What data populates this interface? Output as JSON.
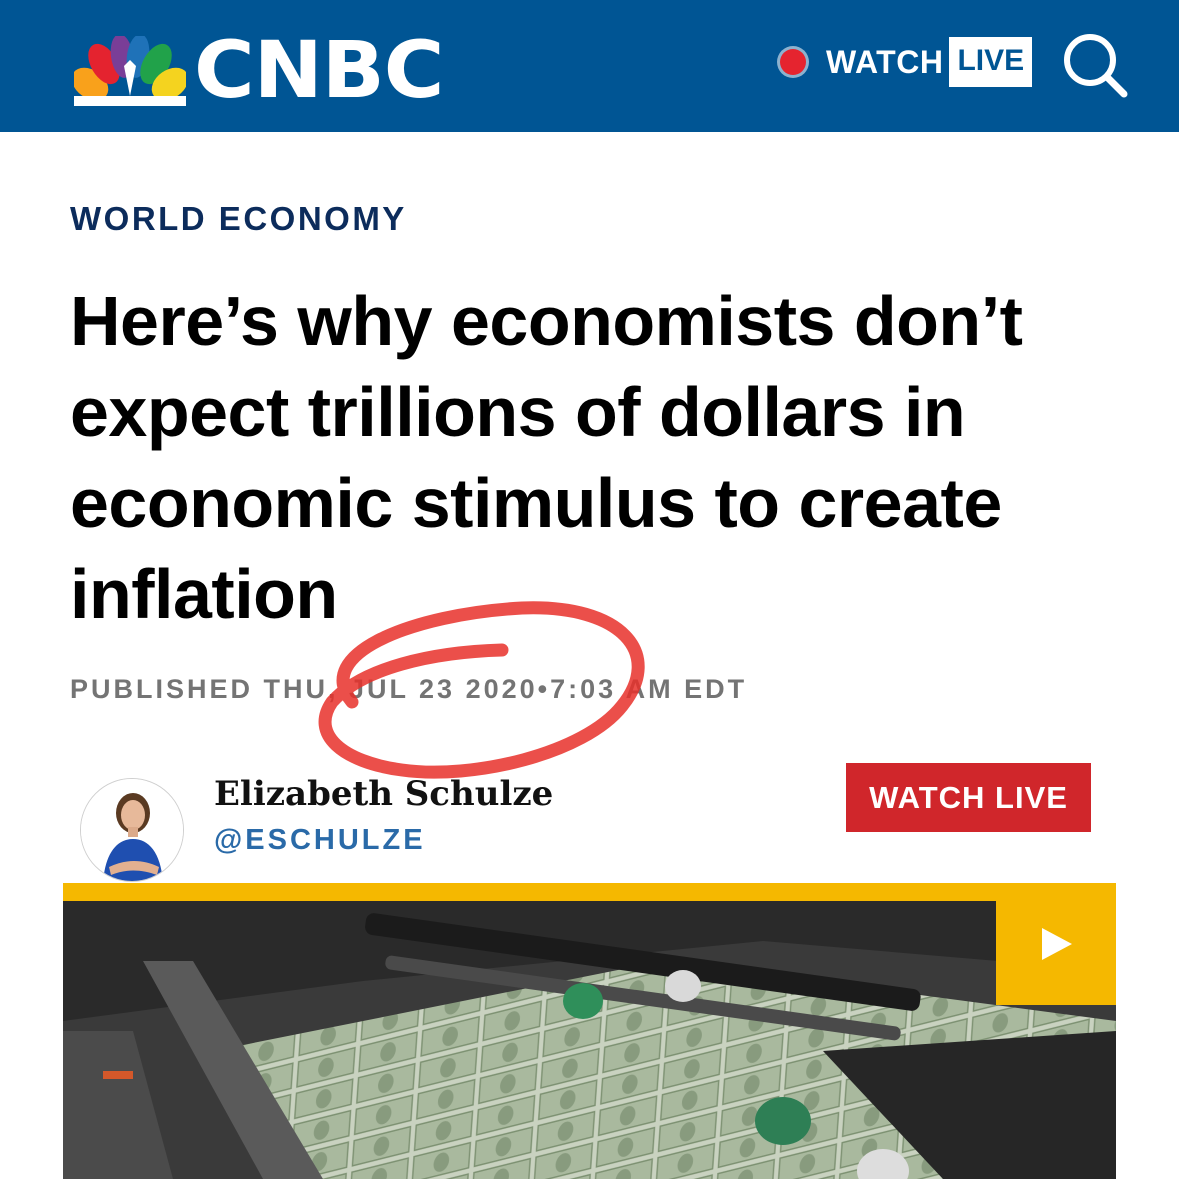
{
  "brand": {
    "name": "CNBC",
    "logo_colors": [
      "#f9a11b",
      "#e4232f",
      "#7a3e97",
      "#1f72b8",
      "#21a24a",
      "#f4d31f"
    ],
    "header_color": "#005594"
  },
  "header": {
    "watch_label": "WATCH",
    "live_label": "LIVE",
    "search_icon": "search-icon"
  },
  "article": {
    "section": "WORLD ECONOMY",
    "headline": "Here’s why economists don’t expect trillions of dollars in economic stimulus to create inflation",
    "dateline": "PUBLISHED THU, JUL 23 2020•7:03 AM EDT"
  },
  "author": {
    "name": "Elizabeth Schulze",
    "handle": "@ESCHULZE"
  },
  "cta": {
    "watch_live": "WATCH LIVE",
    "color": "#d0262b"
  },
  "video": {
    "play_icon": "play-icon",
    "accent_color": "#f5b800"
  },
  "annotation": {
    "color": "#e8302a"
  }
}
